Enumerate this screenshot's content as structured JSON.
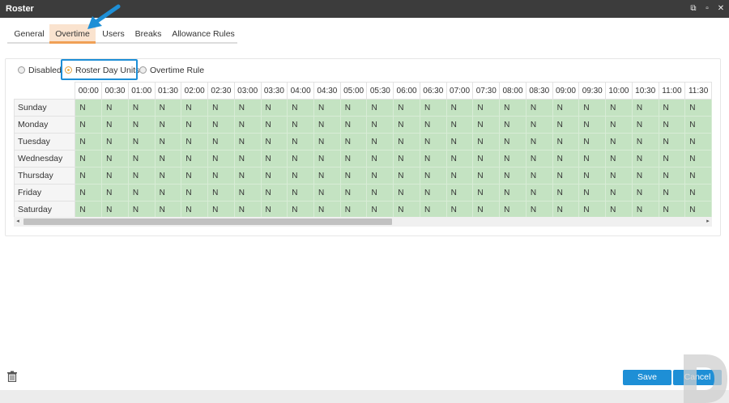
{
  "window": {
    "title": "Roster",
    "controls": {
      "restore": "⧉",
      "maximize": "▫",
      "close": "✕"
    }
  },
  "tabs": [
    {
      "label": "General"
    },
    {
      "label": "Overtime",
      "active": true
    },
    {
      "label": "Users"
    },
    {
      "label": "Breaks"
    },
    {
      "label": "Allowance Rules"
    }
  ],
  "mode": {
    "options": [
      {
        "label": "Disabled",
        "checked": false
      },
      {
        "label": "Roster Day Units",
        "checked": true
      },
      {
        "label": "Overtime Rule",
        "checked": false
      }
    ]
  },
  "grid": {
    "hours": [
      "00:00",
      "00:30",
      "01:00",
      "01:30",
      "02:00",
      "02:30",
      "03:00",
      "03:30",
      "04:00",
      "04:30",
      "05:00",
      "05:30",
      "06:00",
      "06:30",
      "07:00",
      "07:30",
      "08:00",
      "08:30",
      "09:00",
      "09:30",
      "10:00",
      "10:30",
      "11:00",
      "11:30"
    ],
    "days": [
      "Sunday",
      "Monday",
      "Tuesday",
      "Wednesday",
      "Thursday",
      "Friday",
      "Saturday"
    ],
    "cell_value": "N",
    "cell_color": "#c4e3c2"
  },
  "scrollbar": {
    "left_arrow": "◂",
    "right_arrow": "▸"
  },
  "footer": {
    "save_label": "Save",
    "cancel_label": "Cancel",
    "delete_icon": "trash-icon"
  },
  "colors": {
    "accent": "#1e8fd6",
    "titlebar": "#3c3c3c",
    "active_tab_bg": "#fae3cf",
    "active_tab_underline": "#f0a056"
  }
}
